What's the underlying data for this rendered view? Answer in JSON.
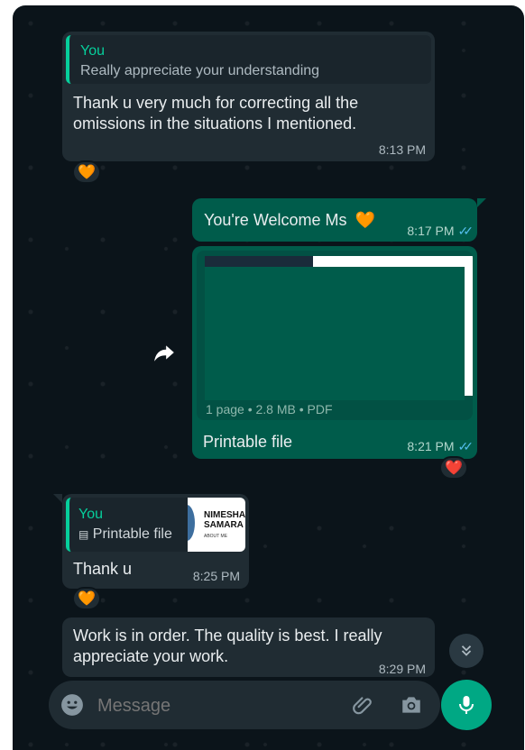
{
  "messages": {
    "m1": {
      "quote_author": "You",
      "quote_text": "Really appreciate your understanding",
      "text": "Thank u very much for correcting all the omissions in the situations I mentioned.",
      "time": "8:13 PM",
      "reaction": "🧡"
    },
    "m2": {
      "text": "You're Welcome Ms",
      "emoji": "🧡",
      "time": "8:17 PM"
    },
    "m3": {
      "file_meta": "1 page • 2.8 MB • PDF",
      "caption": "Printable file",
      "time": "8:21 PM",
      "reaction": "❤️"
    },
    "m4": {
      "quote_author": "You",
      "quote_text": "Printable file",
      "thumb_line1": "NIMESHA",
      "thumb_line2": "SAMARA",
      "thumb_line3": "ABOUT ME",
      "text": "Thank u",
      "time": "8:25 PM",
      "reaction": "🧡"
    },
    "m5": {
      "text": "Work is in order.  The quality is best.  I really appreciate your work.",
      "time": "8:29 PM"
    }
  },
  "composer": {
    "placeholder": "Message"
  },
  "icons": {
    "forward": "forward-icon",
    "emoji": "emoji-icon",
    "attach": "paperclip-icon",
    "camera": "camera-icon",
    "mic": "microphone-icon",
    "scroll": "chevron-double-down-icon",
    "read": "double-check-icon",
    "document": "document-icon"
  },
  "colors": {
    "background": "#0b141a",
    "incoming_bubble": "#202c33",
    "outgoing_bubble": "#005c4b",
    "accent": "#00a884",
    "read_ticks": "#53bdeb"
  }
}
